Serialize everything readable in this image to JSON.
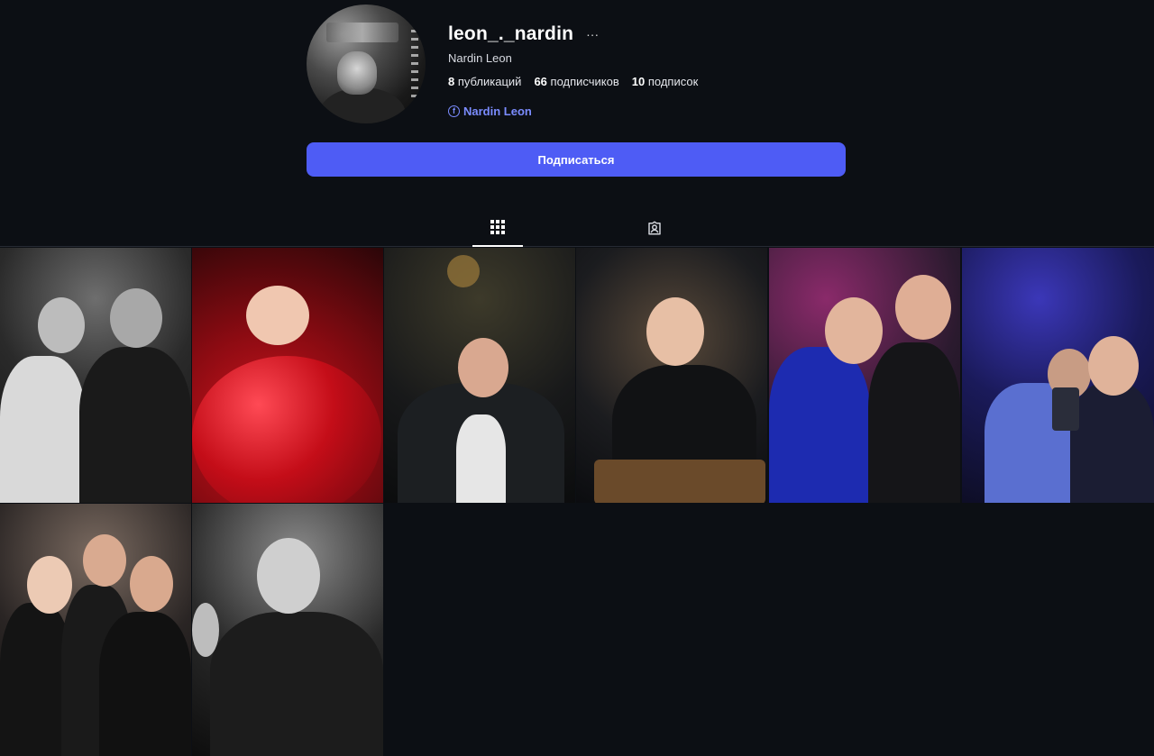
{
  "profile": {
    "username": "leon_._nardin",
    "full_name": "Nardin Leon",
    "more_label": "···",
    "stats": {
      "posts_count": "8",
      "posts_label": "публикаций",
      "followers_count": "66",
      "followers_label": "подписчиков",
      "following_count": "10",
      "following_label": "подписок"
    },
    "link": {
      "icon": "facebook-icon",
      "icon_glyph": "f",
      "text": "Nardin Leon"
    }
  },
  "follow_button": {
    "label": "Подписаться"
  },
  "tabs": [
    {
      "id": "posts",
      "icon": "grid-icon",
      "active": true
    },
    {
      "id": "tagged",
      "icon": "tagged-user-icon",
      "active": false
    }
  ],
  "colors": {
    "background": "#0c0f14",
    "accent": "#4e5cf5",
    "link": "#7b8cff"
  },
  "photos": [
    {
      "name": "photo-1"
    },
    {
      "name": "photo-2"
    },
    {
      "name": "photo-3"
    },
    {
      "name": "photo-4"
    },
    {
      "name": "photo-5"
    },
    {
      "name": "photo-6"
    },
    {
      "name": "photo-7"
    },
    {
      "name": "photo-8"
    }
  ]
}
